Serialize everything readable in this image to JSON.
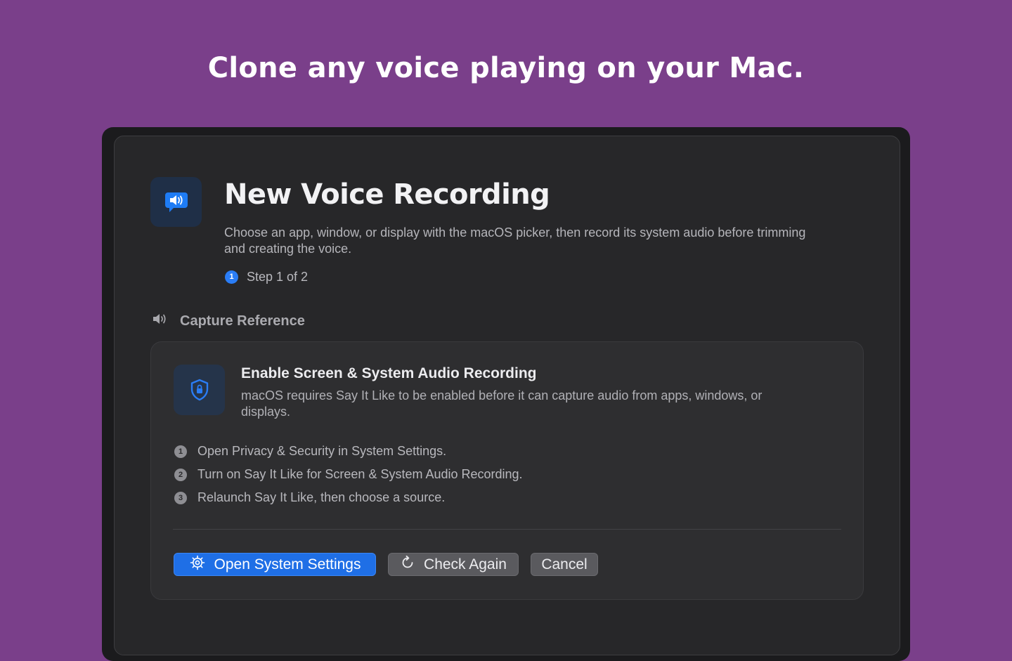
{
  "headline": "Clone any voice playing on your Mac.",
  "dialog": {
    "title": "New Voice Recording",
    "subtitle": "Choose an app, window, or display with the macOS picker, then record its system audio before trimming and creating the voice.",
    "step": {
      "number": "1",
      "label": "Step 1 of 2"
    }
  },
  "section": {
    "icon": "speaker-icon",
    "label": "Capture Reference"
  },
  "permission_card": {
    "icon": "lock-shield-icon",
    "title": "Enable Screen & System Audio Recording",
    "description": "macOS requires Say It Like to be enabled before it can capture audio from apps, windows, or displays.",
    "steps": [
      {
        "number": "1",
        "text": "Open Privacy & Security in System Settings."
      },
      {
        "number": "2",
        "text": "Turn on Say It Like for Screen & System Audio Recording."
      },
      {
        "number": "3",
        "text": "Relaunch Say It Like, then choose a source."
      }
    ]
  },
  "buttons": {
    "open_settings": "Open System Settings",
    "check_again": "Check Again",
    "cancel": "Cancel"
  },
  "colors": {
    "background": "#7a3f8a",
    "accent": "#1f6fe6",
    "window": "#272729",
    "card": "#2e2e30"
  }
}
